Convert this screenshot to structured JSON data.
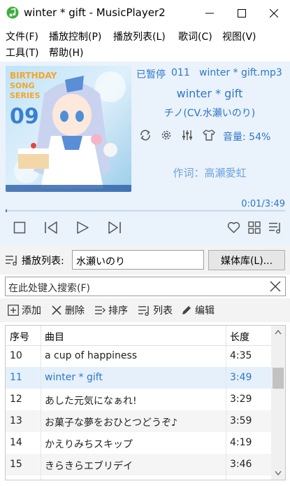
{
  "window": {
    "title": "winter * gift - MusicPlayer2"
  },
  "menus": {
    "row1": [
      "文件(F)",
      "播放控制(P)",
      "播放列表(L)",
      "歌词(C)",
      "视图(V)"
    ],
    "row2": [
      "工具(T)",
      "帮助(H)"
    ]
  },
  "now_playing": {
    "status": "已暂停",
    "index": "011",
    "filename": "winter * gift.mp3",
    "title": "winter * gift",
    "artist": "チノ(CV.水瀬いのり)",
    "volume": "音量: 54%",
    "lyric": "作词：高瀬愛虹",
    "time": "0:01/3:49",
    "progress_fraction": 0.004,
    "cover": {
      "line1": "BIRTHDAY",
      "line2": "SONG",
      "line3": "SERIES",
      "number": "09"
    }
  },
  "playlist": {
    "label": "播放列表:",
    "value": "水瀬いのり",
    "media_button": "媒体库(L)..."
  },
  "search": {
    "placeholder": "在此处键入搜索(F)"
  },
  "toolbar": {
    "add": "添加",
    "delete": "删除",
    "sort": "排序",
    "list": "列表",
    "edit": "编辑"
  },
  "table": {
    "headers": {
      "num": "序号",
      "title": "曲目",
      "length": "长度"
    },
    "rows": [
      {
        "num": "10",
        "title": "a cup of happiness",
        "length": "4:35"
      },
      {
        "num": "11",
        "title": "winter * gift",
        "length": "3:49"
      },
      {
        "num": "12",
        "title": "あした元気になぁれ!",
        "length": "3:29"
      },
      {
        "num": "13",
        "title": "お菓子な夢をおひとつどうぞ♪",
        "length": "3:59"
      },
      {
        "num": "14",
        "title": "かえりみちスキップ",
        "length": "4:19"
      },
      {
        "num": "15",
        "title": "きらきらエブリデイ",
        "length": "3:46"
      }
    ],
    "selected_row": 1
  },
  "colors": {
    "accent": "#2d77c8",
    "panel": "#eaf2fb",
    "selection": "#e5f0fb"
  }
}
